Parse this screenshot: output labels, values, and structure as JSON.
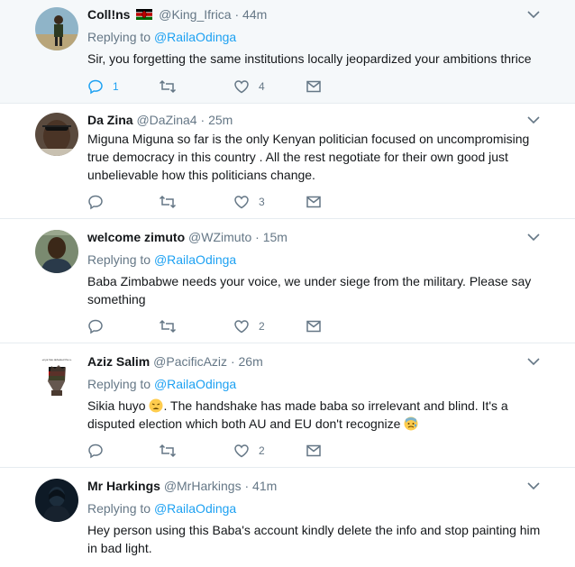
{
  "tweets": [
    {
      "name": "Coll!ns",
      "handle": "@King_Ifrica",
      "time": "44m",
      "replying_label": "Replying to",
      "replying_to": "@RailaOdinga",
      "text": "Sir, you forgetting the same institutions locally jeopardized your ambitions thrice",
      "replies": "1",
      "retweets": "",
      "likes": "4",
      "has_flag": true
    },
    {
      "name": "Da Zina",
      "handle": "@DaZina4",
      "time": "25m",
      "text": "Miguna Miguna so far is the only Kenyan politician  focused on  uncompromising true democracy in this country . All the rest negotiate for their own good just unbelievable how this politicians change.",
      "replies": "",
      "retweets": "",
      "likes": "3"
    },
    {
      "name": "welcome zimuto",
      "handle": "@WZimuto",
      "time": "15m",
      "replying_label": "Replying to",
      "replying_to": "@RailaOdinga",
      "text": "Baba Zimbabwe needs your voice, we under siege from the military. Please say something",
      "replies": "",
      "retweets": "",
      "likes": "2"
    },
    {
      "name": "Aziz Salim",
      "handle": "@PacificAziz",
      "time": "26m",
      "replying_label": "Replying to",
      "replying_to": "@RailaOdinga",
      "text_part1": "Sikia huyo ",
      "text_part2": ". The handshake has made baba so irrelevant and blind. It's a disputed election which both AU and EU don't recognize ",
      "avatar_caption": "Kenya has defeated the AU",
      "replies": "",
      "retweets": "",
      "likes": "2"
    },
    {
      "name": "Mr Harkings",
      "handle": "@MrHarkings",
      "time": "41m",
      "replying_label": "Replying to",
      "replying_to": "@RailaOdinga",
      "text": "Hey person using this Baba's account kindly delete the info and stop painting him in bad light."
    }
  ],
  "separator": "·",
  "colors": {
    "accent": "#1da1f2",
    "secondary_text": "#657786",
    "thread_line": "#a6dcfa",
    "highlight_bg": "#f5f8fa"
  }
}
